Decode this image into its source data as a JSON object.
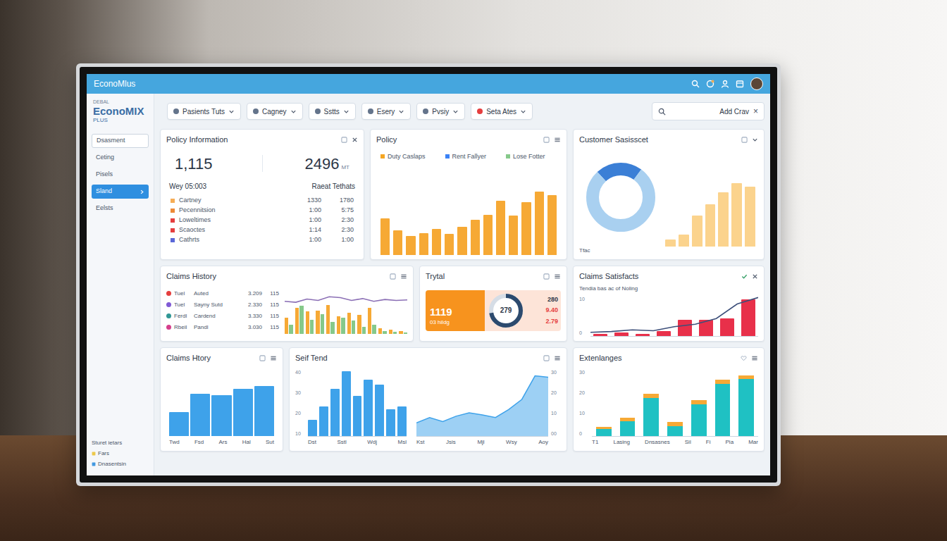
{
  "topbar": {
    "title": "EconoMlus"
  },
  "sidebar": {
    "logo": {
      "top": "DEBAL",
      "main": "EconoMIX",
      "sub": "PLUS"
    },
    "items": [
      {
        "label": "Dsasment",
        "selected": false,
        "kind": "field"
      },
      {
        "label": "Ceting",
        "selected": false,
        "kind": "link"
      },
      {
        "label": "Pisels",
        "selected": false,
        "kind": "link"
      },
      {
        "label": "Sland",
        "selected": true,
        "kind": "link"
      },
      {
        "label": "Eelsts",
        "selected": false,
        "kind": "link"
      }
    ],
    "footer": [
      "Sturet ietars",
      "Fars",
      "Dnasentsin"
    ]
  },
  "filters": [
    {
      "label": "Pasients Tuts",
      "color": "#64748b"
    },
    {
      "label": "Cagney",
      "color": "#64748b"
    },
    {
      "label": "Sstts",
      "color": "#64748b"
    },
    {
      "label": "Esery",
      "color": "#64748b"
    },
    {
      "label": "Pvsiy",
      "color": "#64748b"
    },
    {
      "label": "Seta Ates",
      "color": "#e53e3e"
    }
  ],
  "search": {
    "value": "Add Crav",
    "clear": "×"
  },
  "policy_info": {
    "title": "Policy Information",
    "kpis": [
      "1,115",
      "2496"
    ],
    "kpi_unit": "MT",
    "sub_left": "Wey 05:003",
    "sub_right": "Raeat Tethats",
    "rows": [
      {
        "label": "Cartney",
        "a": "1330",
        "b": "1780",
        "color": "#f6ad55"
      },
      {
        "label": "Pecennitsion",
        "a": "1:00",
        "b": "5:75",
        "color": "#ed8936"
      },
      {
        "label": "Loweltimes",
        "a": "1:00",
        "b": "2:30",
        "color": "#e53e3e"
      },
      {
        "label": "Scaoctes",
        "a": "1:14",
        "b": "2:30",
        "color": "#e53e3e"
      },
      {
        "label": "Cathrts",
        "a": "1:00",
        "b": "1:00",
        "color": "#5a67d8"
      }
    ]
  },
  "policy_chart": {
    "title": "Policy",
    "legend": [
      {
        "label": "Duty Caslaps",
        "color": "#f5a623"
      },
      {
        "label": "Rent Fallyer",
        "color": "#3b82f6"
      },
      {
        "label": "Lose Fotter",
        "color": "#86c98a"
      }
    ],
    "values": [
      42,
      28,
      22,
      25,
      30,
      24,
      32,
      40,
      46,
      62,
      45,
      60,
      72,
      68
    ],
    "max": 80,
    "color": "#f6a935"
  },
  "satisfaction": {
    "title": "Customer Sasisscet",
    "donut": [
      {
        "value": 22,
        "color": "#3b7fd6"
      },
      {
        "value": 78,
        "color": "#a9d0f0"
      }
    ],
    "values": [
      8,
      14,
      35,
      48,
      62,
      72,
      68
    ],
    "max": 80,
    "color": "#fbd38d",
    "footnote": "Tfac"
  },
  "claims_history": {
    "title": "Claims History",
    "rows": [
      {
        "label": "Tuel",
        "sub": "Auted",
        "a": "3.209",
        "b": "115",
        "color": "#e53e3e"
      },
      {
        "label": "Tuel",
        "sub": "Sayny Sutd",
        "a": "2.330",
        "b": "115",
        "color": "#805ad5"
      },
      {
        "label": "Ferdl",
        "sub": "Cardend",
        "a": "3.330",
        "b": "115",
        "color": "#319795"
      },
      {
        "label": "Rbeil",
        "sub": "Pandl",
        "a": "3.030",
        "b": "115",
        "color": "#d53f8c"
      }
    ],
    "series": [
      {
        "color": "#f6a935",
        "values": [
          35,
          55,
          48,
          50,
          62,
          38,
          45,
          40,
          55,
          12,
          8,
          5
        ]
      },
      {
        "color": "#86c98a",
        "values": [
          20,
          60,
          30,
          42,
          25,
          35,
          28,
          15,
          20,
          6,
          4,
          3
        ]
      }
    ],
    "line": [
      70,
      68,
      75,
      72,
      80,
      78,
      72,
      76,
      70,
      74,
      72,
      73
    ],
    "line_color": "#8b6fb5",
    "max": 100
  },
  "trytal": {
    "title": "Trytal",
    "value": "1119",
    "caption": "03 hildg",
    "gauge": {
      "level": 0.72,
      "reading": "279"
    },
    "side": [
      {
        "text": "280",
        "color": "#2d3748"
      },
      {
        "text": "9.40",
        "color": "#e53e3e"
      },
      {
        "text": "2.79",
        "color": "#e53e3e"
      }
    ]
  },
  "claims_satisfaction": {
    "title": "Claims Satisfacts",
    "subtitle": "Tendia bas ac of Noling",
    "ticks": [
      "10",
      "0"
    ],
    "values": [
      3,
      4,
      3,
      6,
      20,
      20,
      22,
      45
    ],
    "line": [
      5,
      6,
      8,
      7,
      12,
      15,
      22,
      40,
      48
    ],
    "max": 50,
    "color": "#e8304a"
  },
  "claims_story": {
    "title": "Claims Htory",
    "values": [
      40,
      70,
      68,
      78,
      82
    ],
    "max": 100,
    "color": "#3ea2ea",
    "labels": [
      "Twd",
      "Fsd",
      "Ars",
      "Hal",
      "Sut"
    ]
  },
  "self_trend": {
    "title": "Seif Tend",
    "left_ticks": [
      "40",
      "30",
      "20",
      "10"
    ],
    "right_ticks": [
      "30",
      "20",
      "10",
      "00"
    ],
    "bars": [
      12,
      22,
      35,
      48,
      30,
      42,
      38,
      20,
      22
    ],
    "bars_max": 50,
    "bar_color": "#3ea2ea",
    "area": [
      20,
      28,
      22,
      30,
      35,
      32,
      28,
      40,
      55,
      90,
      88
    ],
    "area_max": 100,
    "area_color": "#7cc0f0",
    "bar_labels": [
      "Dst",
      "Sstl",
      "Wdj",
      "Msl"
    ],
    "area_labels": [
      "Kst",
      "Jsis",
      "Mjl",
      "Wsy",
      "Aoy"
    ]
  },
  "exchanges": {
    "title": "Extenlanges",
    "ticks": [
      "30",
      "20",
      "10",
      "0"
    ],
    "base": [
      8,
      18,
      45,
      12,
      38,
      62,
      68
    ],
    "top": [
      3,
      4,
      5,
      5,
      5,
      5,
      4
    ],
    "max": 80,
    "base_color": "#1fc1c3",
    "top_color": "#f6a935",
    "labels": [
      "T1",
      "Lasing",
      "Dnsasnes",
      "Sil",
      "Fi",
      "Pia",
      "Mar"
    ]
  }
}
